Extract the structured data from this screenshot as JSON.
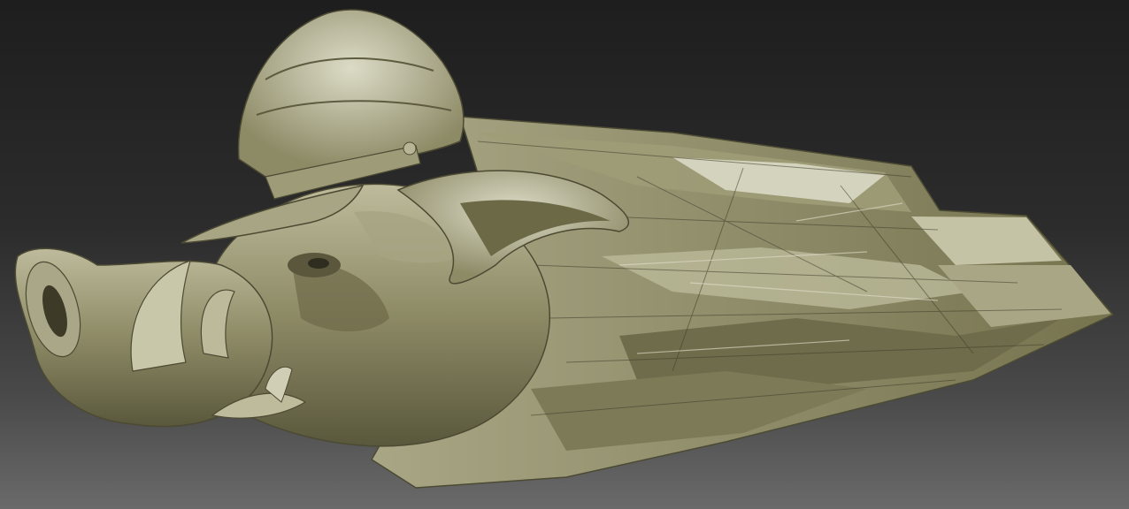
{
  "scene": {
    "background_top": "#1e1e1e",
    "background_bottom": "#6a6a6a",
    "clay_base": "#8d8a66",
    "clay_light": "#c3c1a3",
    "clay_dark": "#4c4a33",
    "clay_highlight": "#d9d8c2",
    "subject_icon": "boar-head-sculpt-icon"
  }
}
